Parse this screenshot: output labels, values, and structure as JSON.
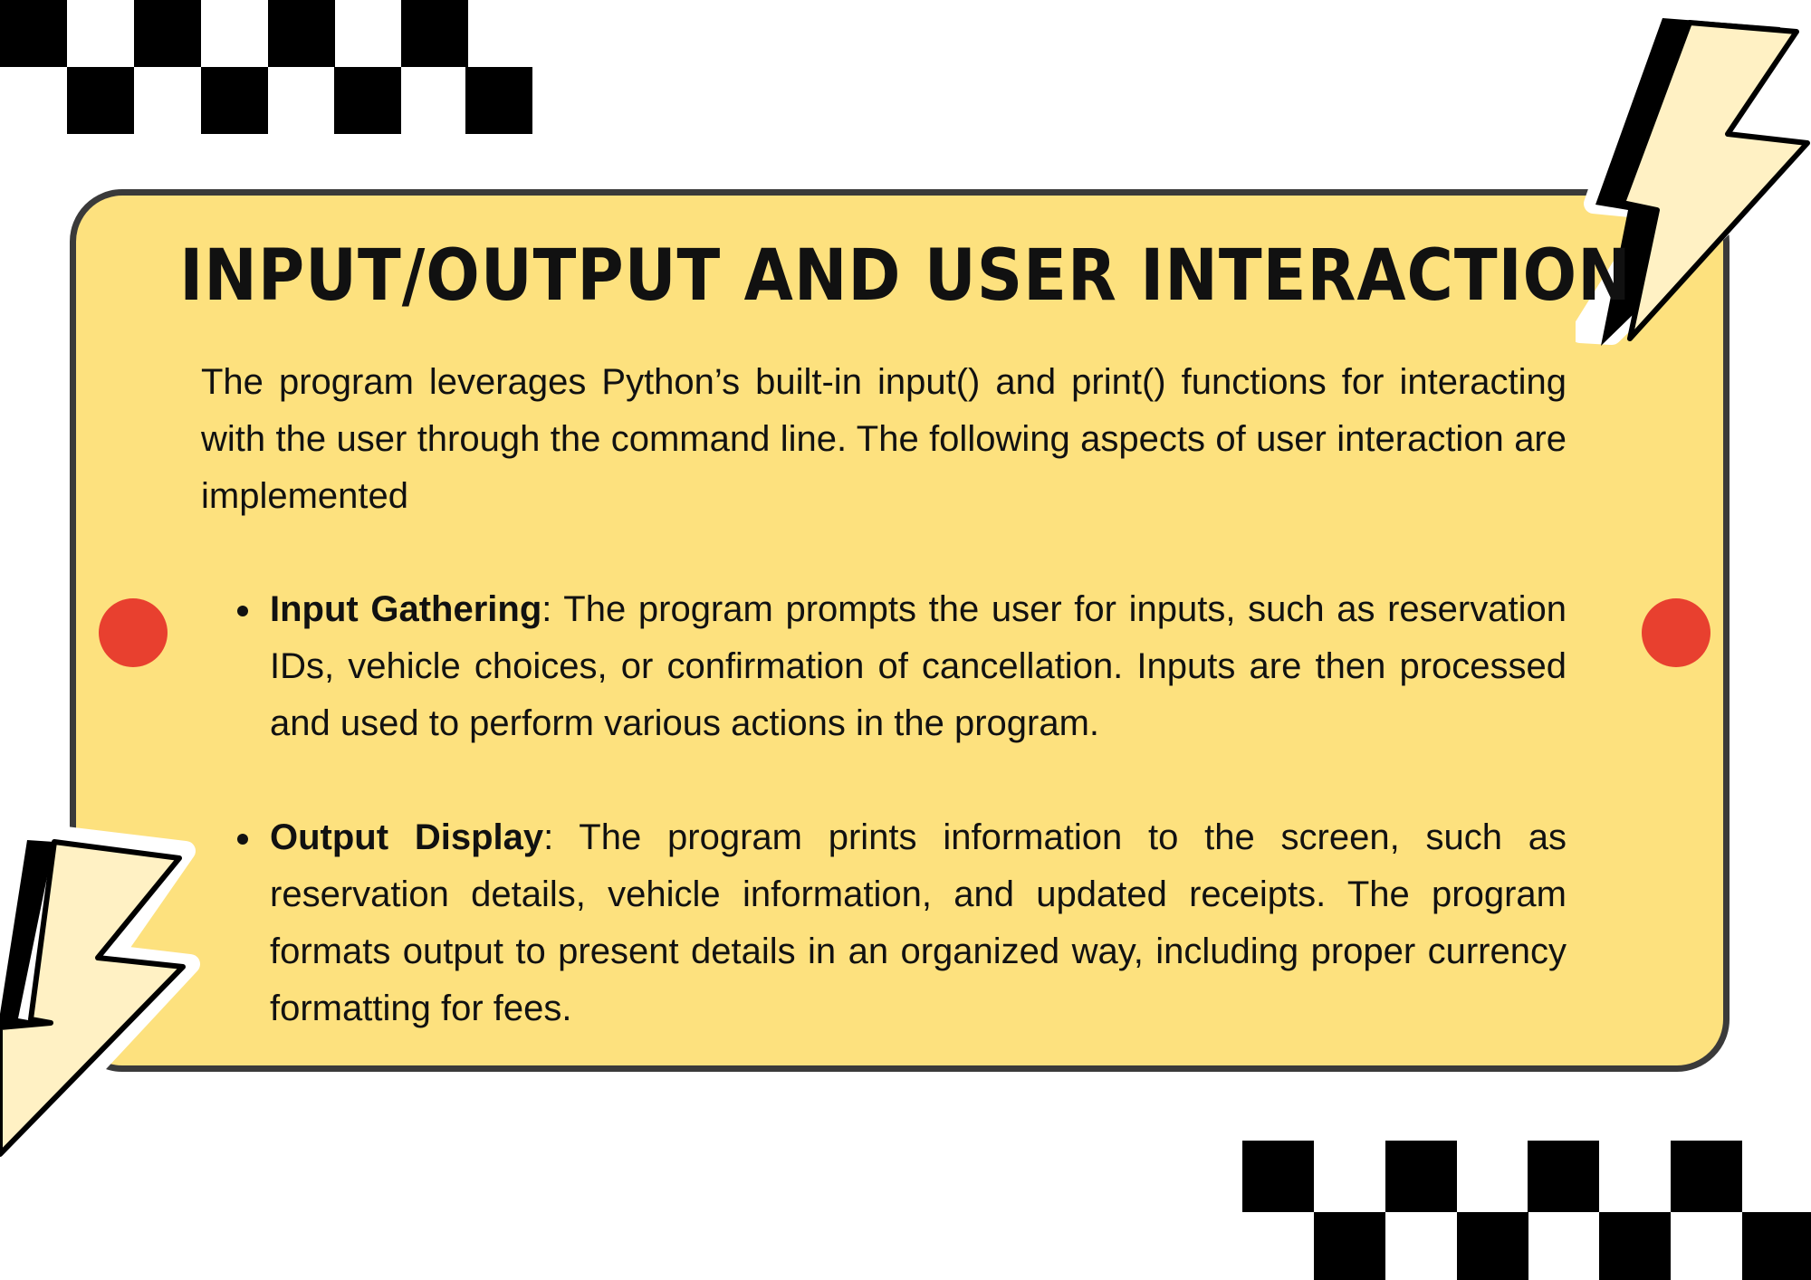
{
  "title": "INPUT/OUTPUT AND USER INTERACTION",
  "intro": "The program leverages Python’s built-in input() and print() functions for interacting with the user through the command line. The following aspects of user interaction are implemented",
  "bullets": [
    {
      "term": "Input Gathering",
      "text": ": The program prompts the user for inputs, such as reservation IDs, vehicle choices, or confirmation of cancellation. Inputs are then processed and used to perform various actions in the program."
    },
    {
      "term": "Output Display",
      "text": ": The program prints information to the screen, such as reservation details, vehicle information, and updated receipts. The program formats output to present details in an organized way, including proper currency formatting for fees."
    }
  ],
  "colors": {
    "card_background": "#fde17e",
    "card_border": "#3a3a3a",
    "accent_red": "#e8402f",
    "bolt_fill": "#fff1c4",
    "checker": "#000000"
  },
  "decorations": {
    "icons": [
      "checkerboard-pattern",
      "lightning-bolt-icon",
      "red-dot"
    ]
  }
}
